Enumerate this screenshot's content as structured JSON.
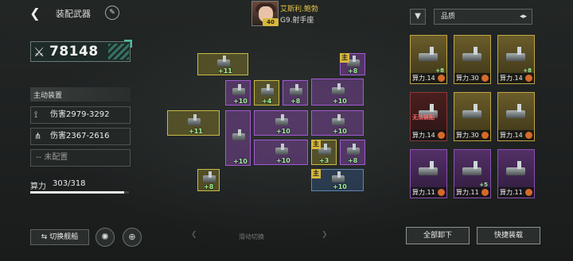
{
  "header": {
    "title": "装配武器",
    "back_icon": "chevron-left-icon",
    "edit_icon": "brush-icon"
  },
  "pilot": {
    "name": "艾斯利.鲍勃",
    "class_label": "G9.射手座",
    "level": "40"
  },
  "power": {
    "icon": "crossed-swords-icon",
    "value": "78148"
  },
  "active_equipment": {
    "header": "主动装置",
    "rows": [
      {
        "icon": "claw-icon",
        "text": "伤害2979-3292"
      },
      {
        "icon": "spread-shot-icon",
        "text": "伤害2367-2616"
      },
      {
        "icon": "",
        "text": "-- 未配置"
      }
    ]
  },
  "energy": {
    "label": "算力",
    "current": "303",
    "max": "318",
    "display": "303/318",
    "fraction": 0.953
  },
  "bottom_left": {
    "switch_ship_label": "切换舰船",
    "switch_ship_icon": "swap-icon",
    "round_buttons": [
      "radar-icon",
      "target-icon"
    ]
  },
  "grid": {
    "slots": [
      {
        "bonus": "+11",
        "main": false
      },
      {
        "bonus": "+8",
        "main": true
      },
      {
        "bonus": "+10",
        "main": false
      },
      {
        "bonus": "+4",
        "main": false
      },
      {
        "bonus": "+8",
        "main": false
      },
      {
        "bonus": "+10",
        "main": false
      },
      {
        "bonus": "+11",
        "main": false
      },
      {
        "bonus": "+10",
        "main": false
      },
      {
        "bonus": "+10",
        "main": false
      },
      {
        "bonus": "+10",
        "main": false
      },
      {
        "bonus": "+3",
        "main": true
      },
      {
        "bonus": "+8",
        "main": false
      },
      {
        "bonus": "+10",
        "main": false
      },
      {
        "bonus": "+10",
        "main": true
      },
      {
        "bonus": "+8",
        "main": false
      }
    ],
    "main_badge": "主"
  },
  "slide_hint": "滑动切换",
  "right_panel": {
    "filter_icon": "filter-icon",
    "quality_label": "品质",
    "quality_sort_icon": "sort-toggle-icon",
    "cards": [
      {
        "power_label": "算力.14",
        "bonus": "+8",
        "rarity": "gold"
      },
      {
        "power_label": "算力.30",
        "bonus": "",
        "rarity": "gold"
      },
      {
        "power_label": "算力.14",
        "bonus": "+8",
        "rarity": "gold"
      },
      {
        "power_label": "算力.14",
        "bonus": "",
        "rarity": "red",
        "note": "无法装配"
      },
      {
        "power_label": "算力.30",
        "bonus": "",
        "rarity": "gold"
      },
      {
        "power_label": "算力.14",
        "bonus": "",
        "rarity": "gold"
      },
      {
        "power_label": "算力.11",
        "bonus": "",
        "rarity": "purple"
      },
      {
        "power_label": "算力.11",
        "bonus": "+5",
        "rarity": "purple"
      },
      {
        "power_label": "算力.11",
        "bonus": "",
        "rarity": "purple"
      }
    ],
    "unload_all_label": "全部卸下",
    "quick_equip_label": "快捷装载"
  },
  "colors": {
    "accent_teal": "#41c2a0",
    "gold": "#d7b73a",
    "purple": "#a25ad2",
    "bonus_green": "#9ef09a",
    "warning_red": "#ff6b6b"
  }
}
